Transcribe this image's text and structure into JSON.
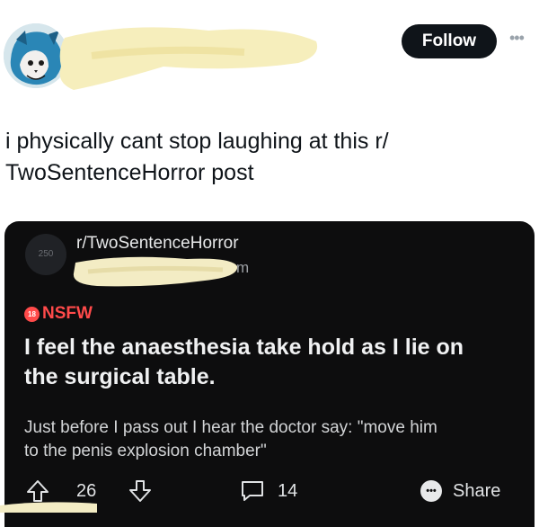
{
  "tweet": {
    "follow_label": "Follow",
    "more_icon": "more-horizontal-icon",
    "text_lines": [
      "i physically cant stop laughing at this r/",
      "TwoSentenceHorror post"
    ]
  },
  "reddit_post": {
    "subreddit_icon_text": "250",
    "subreddit": "r/TwoSentenceHorror",
    "time_suffix": "m",
    "nsfw_badge": "18",
    "nsfw_label": "NSFW",
    "title_lines": [
      "I feel the anaesthesia take hold as I lie on",
      "the surgical table."
    ],
    "body_lines": [
      "Just before I pass out I hear the doctor say: \"move him",
      "to the penis explosion chamber\""
    ],
    "upvotes": "26",
    "comments": "14",
    "share_label": "Share"
  },
  "colors": {
    "follow_bg": "#0f1419",
    "card_bg": "#0d0d0e",
    "nsfw": "#ff4a4a",
    "redaction": "#f6eebc"
  }
}
